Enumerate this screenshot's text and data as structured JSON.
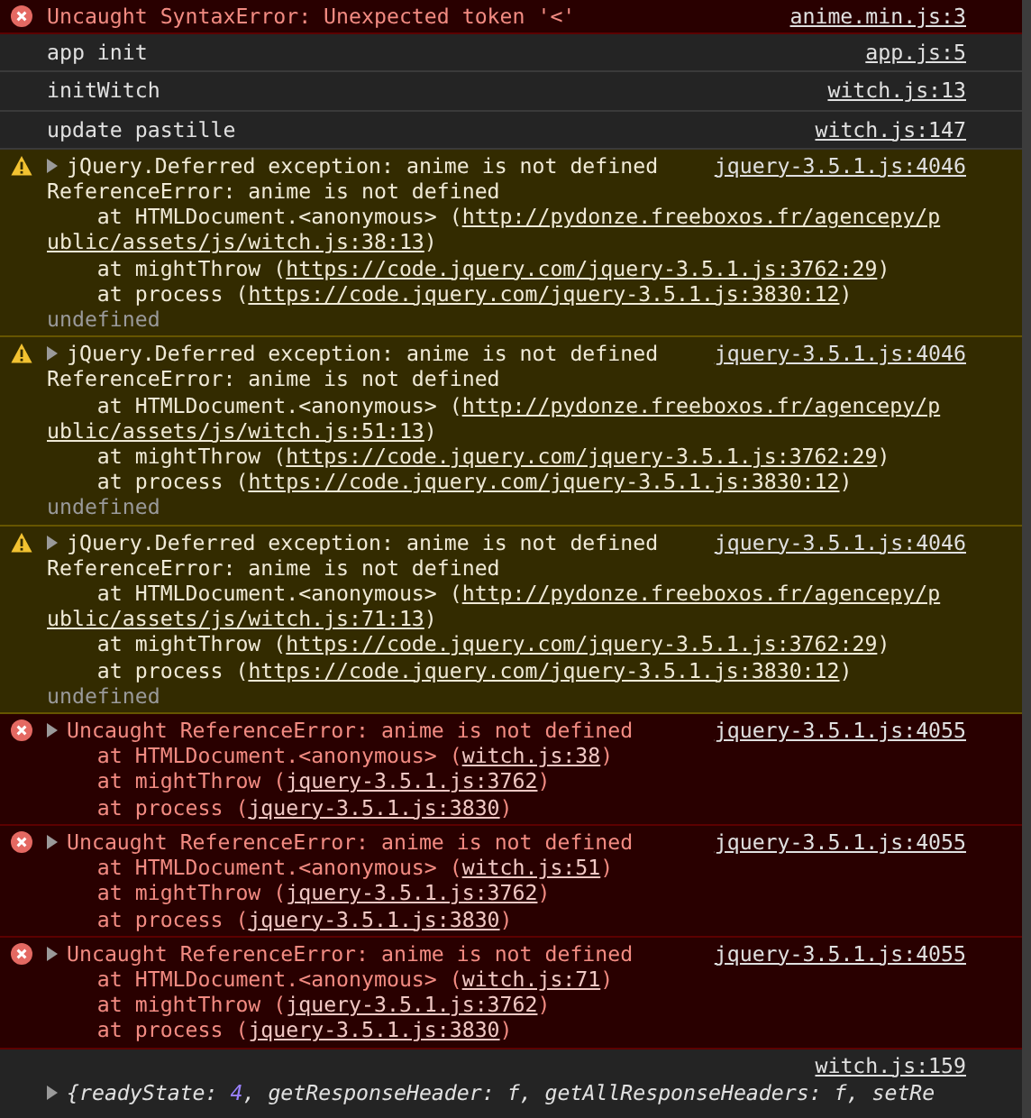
{
  "entries": [
    {
      "kind": "error",
      "expandable": false,
      "source": "anime.min.js:3",
      "lines": [
        [
          {
            "text": "Uncaught SyntaxError: Unexpected token '<'"
          }
        ]
      ]
    },
    {
      "kind": "log",
      "expandable": false,
      "source": "app.js:5",
      "lines": [
        [
          {
            "text": "app init"
          }
        ]
      ]
    },
    {
      "kind": "log",
      "expandable": false,
      "source": "witch.js:13",
      "lines": [
        [
          {
            "text": "initWitch"
          }
        ]
      ]
    },
    {
      "kind": "log",
      "expandable": false,
      "source": "witch.js:147",
      "lines": [
        [
          {
            "text": "update pastille"
          }
        ]
      ]
    },
    {
      "kind": "warning",
      "expandable": true,
      "source": "jquery-3.5.1.js:4046",
      "lines": [
        [
          {
            "text": "jQuery.Deferred exception: anime is not defined"
          }
        ],
        [
          {
            "text": "ReferenceError: anime is not defined"
          }
        ],
        [
          {
            "text": "    at HTMLDocument.<anonymous> ("
          },
          {
            "text": "http://pydonze.freeboxos.fr/agencepy/p",
            "kind": "link"
          }
        ],
        [
          {
            "text": "ublic/assets/js/witch.js:38:13",
            "kind": "link"
          },
          {
            "text": ")"
          }
        ],
        [
          {
            "text": "    at mightThrow ("
          },
          {
            "text": "https://code.jquery.com/jquery-3.5.1.js:3762:29",
            "kind": "link"
          },
          {
            "text": ")"
          }
        ],
        [
          {
            "text": "    at process ("
          },
          {
            "text": "https://code.jquery.com/jquery-3.5.1.js:3830:12",
            "kind": "link"
          },
          {
            "text": ")"
          }
        ],
        [
          {
            "text": "undefined",
            "kind": "dim"
          }
        ]
      ]
    },
    {
      "kind": "warning",
      "expandable": true,
      "source": "jquery-3.5.1.js:4046",
      "lines": [
        [
          {
            "text": "jQuery.Deferred exception: anime is not defined"
          }
        ],
        [
          {
            "text": "ReferenceError: anime is not defined"
          }
        ],
        [
          {
            "text": "    at HTMLDocument.<anonymous> ("
          },
          {
            "text": "http://pydonze.freeboxos.fr/agencepy/p",
            "kind": "link"
          }
        ],
        [
          {
            "text": "ublic/assets/js/witch.js:51:13",
            "kind": "link"
          },
          {
            "text": ")"
          }
        ],
        [
          {
            "text": "    at mightThrow ("
          },
          {
            "text": "https://code.jquery.com/jquery-3.5.1.js:3762:29",
            "kind": "link"
          },
          {
            "text": ")"
          }
        ],
        [
          {
            "text": "    at process ("
          },
          {
            "text": "https://code.jquery.com/jquery-3.5.1.js:3830:12",
            "kind": "link"
          },
          {
            "text": ")"
          }
        ],
        [
          {
            "text": "undefined",
            "kind": "dim"
          }
        ]
      ]
    },
    {
      "kind": "warning",
      "expandable": true,
      "source": "jquery-3.5.1.js:4046",
      "lines": [
        [
          {
            "text": "jQuery.Deferred exception: anime is not defined"
          }
        ],
        [
          {
            "text": "ReferenceError: anime is not defined"
          }
        ],
        [
          {
            "text": "    at HTMLDocument.<anonymous> ("
          },
          {
            "text": "http://pydonze.freeboxos.fr/agencepy/p",
            "kind": "link"
          }
        ],
        [
          {
            "text": "ublic/assets/js/witch.js:71:13",
            "kind": "link"
          },
          {
            "text": ")"
          }
        ],
        [
          {
            "text": "    at mightThrow ("
          },
          {
            "text": "https://code.jquery.com/jquery-3.5.1.js:3762:29",
            "kind": "link"
          },
          {
            "text": ")"
          }
        ],
        [
          {
            "text": "    at process ("
          },
          {
            "text": "https://code.jquery.com/jquery-3.5.1.js:3830:12",
            "kind": "link"
          },
          {
            "text": ")"
          }
        ],
        [
          {
            "text": "undefined",
            "kind": "dim"
          }
        ]
      ]
    },
    {
      "kind": "error",
      "expandable": true,
      "source": "jquery-3.5.1.js:4055",
      "lines": [
        [
          {
            "text": "Uncaught ReferenceError: anime is not defined"
          }
        ],
        [
          {
            "text": "    at HTMLDocument.<anonymous> ("
          },
          {
            "text": "witch.js:38",
            "kind": "link"
          },
          {
            "text": ")"
          }
        ],
        [
          {
            "text": "    at mightThrow ("
          },
          {
            "text": "jquery-3.5.1.js:3762",
            "kind": "link"
          },
          {
            "text": ")"
          }
        ],
        [
          {
            "text": "    at process ("
          },
          {
            "text": "jquery-3.5.1.js:3830",
            "kind": "link"
          },
          {
            "text": ")"
          }
        ]
      ]
    },
    {
      "kind": "error",
      "expandable": true,
      "source": "jquery-3.5.1.js:4055",
      "lines": [
        [
          {
            "text": "Uncaught ReferenceError: anime is not defined"
          }
        ],
        [
          {
            "text": "    at HTMLDocument.<anonymous> ("
          },
          {
            "text": "witch.js:51",
            "kind": "link"
          },
          {
            "text": ")"
          }
        ],
        [
          {
            "text": "    at mightThrow ("
          },
          {
            "text": "jquery-3.5.1.js:3762",
            "kind": "link"
          },
          {
            "text": ")"
          }
        ],
        [
          {
            "text": "    at process ("
          },
          {
            "text": "jquery-3.5.1.js:3830",
            "kind": "link"
          },
          {
            "text": ")"
          }
        ]
      ]
    },
    {
      "kind": "error",
      "expandable": true,
      "source": "jquery-3.5.1.js:4055",
      "lines": [
        [
          {
            "text": "Uncaught ReferenceError: anime is not defined"
          }
        ],
        [
          {
            "text": "    at HTMLDocument.<anonymous> ("
          },
          {
            "text": "witch.js:71",
            "kind": "link"
          },
          {
            "text": ")"
          }
        ],
        [
          {
            "text": "    at mightThrow ("
          },
          {
            "text": "jquery-3.5.1.js:3762",
            "kind": "link"
          },
          {
            "text": ")"
          }
        ],
        [
          {
            "text": "    at process ("
          },
          {
            "text": "jquery-3.5.1.js:3830",
            "kind": "link"
          },
          {
            "text": ")"
          }
        ]
      ]
    },
    {
      "kind": "object",
      "expandable": true,
      "source": "witch.js:159",
      "lines": [
        [
          {
            "text": "{readyState: "
          },
          {
            "text": "4",
            "kind": "number"
          },
          {
            "text": ", getResponseHeader: f, getAllResponseHeaders: f, setRe"
          }
        ]
      ]
    }
  ]
}
